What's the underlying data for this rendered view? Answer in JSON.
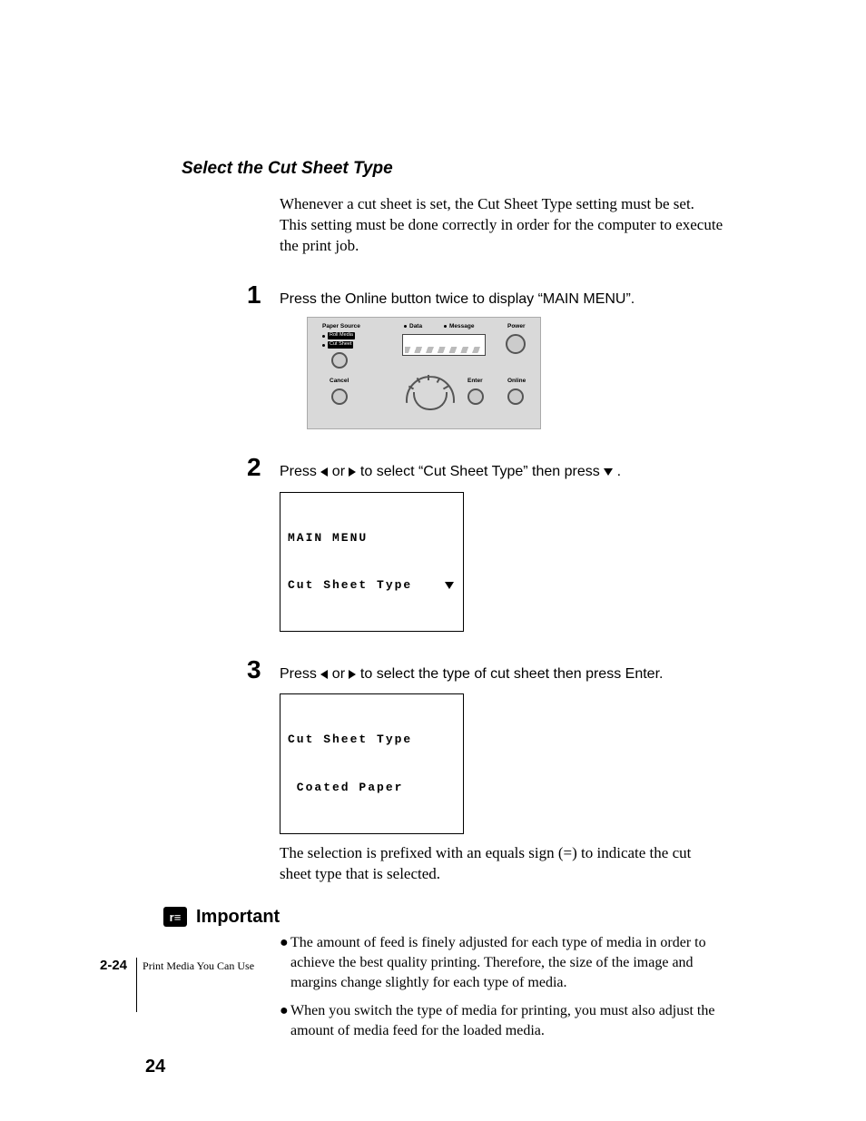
{
  "heading": "Select the Cut Sheet Type",
  "intro": "Whenever a cut sheet is set, the Cut Sheet Type setting must be set. This setting must be done correctly in order for the computer to execute the print job.",
  "steps": {
    "s1": {
      "num": "1",
      "text": "Press the Online button twice to display “MAIN MENU”."
    },
    "s2": {
      "num": "2",
      "textA": "Press ",
      "textB": " or ",
      "textC": " to select “Cut Sheet Type” then press ",
      "textD": "."
    },
    "s3": {
      "num": "3",
      "textA": "Press ",
      "textB": " or ",
      "textC": " to select the type of cut sheet then press Enter."
    }
  },
  "panel": {
    "paper_source": "Paper Source",
    "roll_media": "Roll Media",
    "cut_sheet": "Cut Sheet",
    "cancel": "Cancel",
    "data": "Data",
    "message": "Message",
    "power": "Power",
    "enter": "Enter",
    "online": "Online"
  },
  "lcd1": {
    "line1": "MAIN MENU",
    "line2": "Cut Sheet Type"
  },
  "lcd2": {
    "line1": "Cut Sheet Type",
    "line2": " Coated Paper"
  },
  "selection_note": "The selection is prefixed with an equals sign (=) to indicate the cut sheet type that is selected.",
  "important": {
    "label": "Important",
    "b1": "The amount of feed is finely adjusted for each type of media in order to achieve the best quality printing. Therefore, the size of the image and margins change slightly for each type of media.",
    "b2": "When you switch the type of media for printing, you must also adjust the amount of media feed for the loaded media."
  },
  "footer": {
    "page": "2-24",
    "caption": "Print Media You Can Use",
    "corner": "24"
  }
}
